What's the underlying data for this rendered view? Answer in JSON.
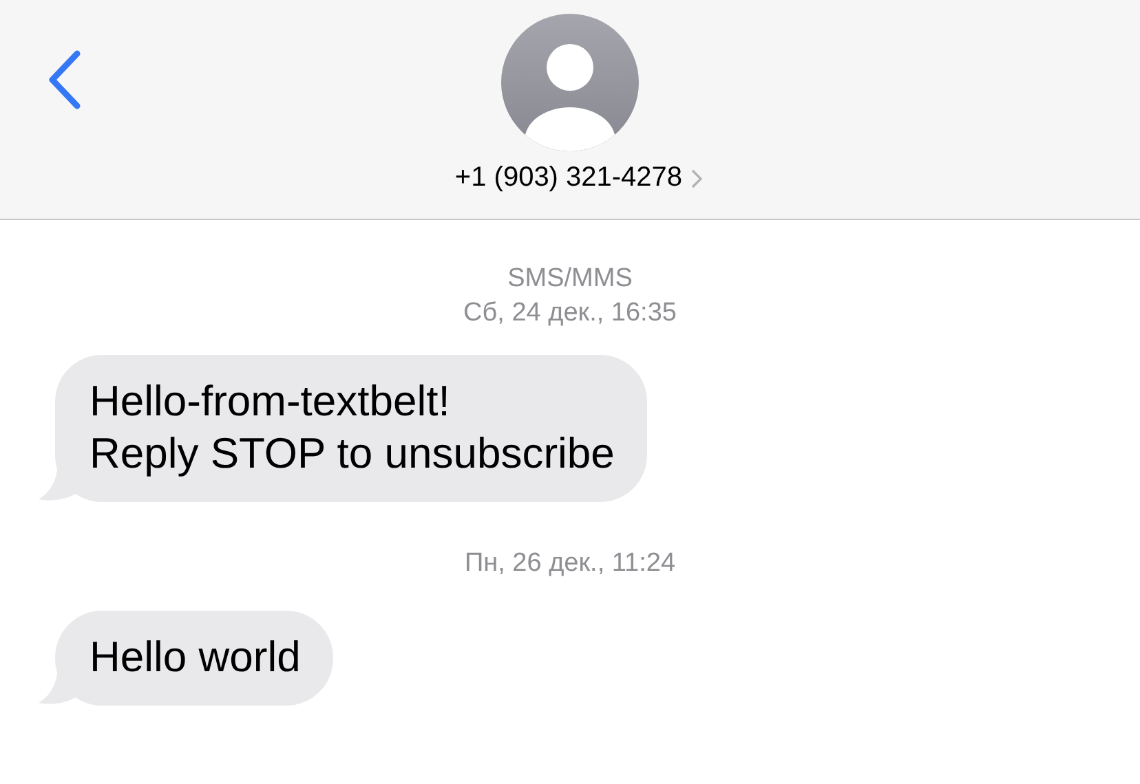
{
  "header": {
    "contact": "+1 (903) 321-4278"
  },
  "thread": [
    {
      "kind": "service",
      "text": "SMS/MMS"
    },
    {
      "kind": "timestamp",
      "text": "Сб, 24 дек., 16:35"
    },
    {
      "kind": "bubble",
      "lines": [
        "Hello-from-textbelt!",
        "Reply STOP to unsubscribe"
      ]
    },
    {
      "kind": "timestamp",
      "text": "Пн, 26 дек., 11:24"
    },
    {
      "kind": "bubble",
      "lines": [
        "Hello world"
      ]
    }
  ]
}
